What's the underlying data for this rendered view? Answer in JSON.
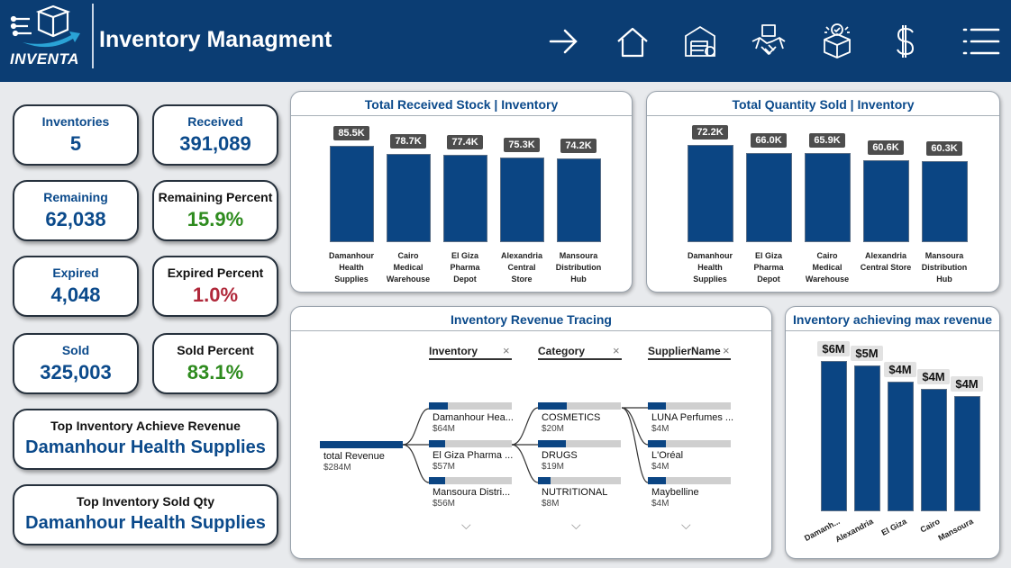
{
  "header": {
    "logo_text": "INVENTA",
    "title": "Inventory Managment",
    "nav_icons": [
      "arrow-right-icon",
      "home-icon",
      "warehouse-icon",
      "handshake-icon",
      "box-check-icon",
      "dollar-icon",
      "menu-icon"
    ]
  },
  "kpis": {
    "inventories": {
      "label": "Inventories",
      "value": "5"
    },
    "received": {
      "label": "Received",
      "value": "391,089"
    },
    "remaining": {
      "label": "Remaining",
      "value": "62,038"
    },
    "remaining_percent": {
      "label": "Remaining Percent",
      "value": "15.9%"
    },
    "expired": {
      "label": "Expired",
      "value": "4,048"
    },
    "expired_percent": {
      "label": "Expired Percent",
      "value": "1.0%"
    },
    "sold": {
      "label": "Sold",
      "value": "325,003"
    },
    "sold_percent": {
      "label": "Sold Percent",
      "value": "83.1%"
    },
    "top_revenue": {
      "label": "Top Inventory Achieve Revenue",
      "value": "Damanhour Health Supplies"
    },
    "top_sold": {
      "label": "Top Inventory Sold Qty",
      "value": "Damanhour Health Supplies"
    }
  },
  "colors": {
    "header": "#0b3d73",
    "bar": "#0b4583",
    "accent": "#0b4a8b",
    "good": "#2e8b1e",
    "bad": "#b0283a"
  },
  "chart_data": [
    {
      "type": "bar",
      "title": "Total Received Stock | Inventory",
      "categories": [
        "Damanhour Health Supplies",
        "Cairo Medical Warehouse",
        "El Giza Pharma Depot",
        "Alexandria Central Store",
        "Mansoura Distribution Hub"
      ],
      "category_lines": [
        [
          "Damanhour",
          "Health",
          "Supplies"
        ],
        [
          "Cairo",
          "Medical",
          "Warehouse"
        ],
        [
          "El Giza",
          "Pharma",
          "Depot"
        ],
        [
          "Alexandria",
          "Central",
          "Store"
        ],
        [
          "Mansoura",
          "Distribution",
          "Hub"
        ]
      ],
      "values": [
        85500,
        78700,
        77400,
        75300,
        74200
      ],
      "labels": [
        "85.5K",
        "78.7K",
        "77.4K",
        "75.3K",
        "74.2K"
      ],
      "ylim": [
        0,
        85500
      ]
    },
    {
      "type": "bar",
      "title": "Total Quantity Sold | Inventory",
      "categories": [
        "Damanhour Health Supplies",
        "El Giza Pharma Depot",
        "Cairo Medical Warehouse",
        "Alexandria Central Store",
        "Mansoura Distribution Hub"
      ],
      "category_lines": [
        [
          "Damanhour",
          "Health",
          "Supplies"
        ],
        [
          "El Giza",
          "Pharma",
          "Depot"
        ],
        [
          "Cairo",
          "Medical",
          "Warehouse"
        ],
        [
          "Alexandria",
          "Central Store"
        ],
        [
          "Mansoura",
          "Distribution",
          "Hub"
        ]
      ],
      "values": [
        72200,
        66000,
        65900,
        60600,
        60300
      ],
      "labels": [
        "72.2K",
        "66.0K",
        "65.9K",
        "60.6K",
        "60.3K"
      ],
      "ylim": [
        0,
        72200
      ]
    },
    {
      "type": "bar",
      "title": "Inventory achieving max revenue",
      "categories": [
        "Damanh...",
        "Alexandria",
        "El Giza",
        "Cairo",
        "Mansoura"
      ],
      "values": [
        64,
        62,
        55,
        52,
        49
      ],
      "labels": [
        "$6M",
        "$5M",
        "$4M",
        "$4M",
        "$4M"
      ],
      "ylim": [
        0,
        64
      ]
    }
  ],
  "tree": {
    "title": "Inventory Revenue Tracing",
    "headers": [
      "Inventory",
      "Category",
      "SupplierName"
    ],
    "close_glyph": "×",
    "root": {
      "name": "total Revenue",
      "value": "$284M"
    },
    "levels": [
      [
        {
          "name": "Damanhour Hea...",
          "value": "$64M",
          "fill": 0.23
        },
        {
          "name": "El Giza Pharma ...",
          "value": "$57M",
          "fill": 0.2
        },
        {
          "name": "Mansoura Distri...",
          "value": "$56M",
          "fill": 0.2
        }
      ],
      [
        {
          "name": "COSMETICS",
          "value": "$20M",
          "fill": 0.35
        },
        {
          "name": "DRUGS",
          "value": "$19M",
          "fill": 0.34
        },
        {
          "name": "NUTRITIONAL",
          "value": "$8M",
          "fill": 0.15
        }
      ],
      [
        {
          "name": "LUNA Perfumes ...",
          "value": "$4M",
          "fill": 0.22
        },
        {
          "name": "L'Oréal",
          "value": "$4M",
          "fill": 0.22
        },
        {
          "name": "Maybelline",
          "value": "$4M",
          "fill": 0.22
        }
      ]
    ]
  }
}
